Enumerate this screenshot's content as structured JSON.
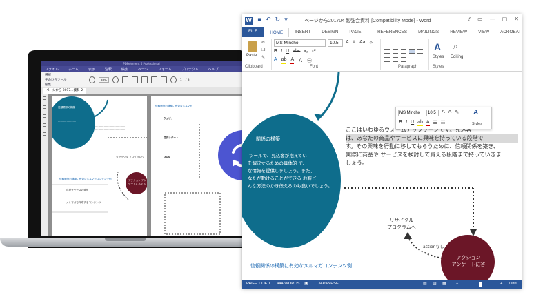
{
  "pdf": {
    "title": "PDFelement 6 Professional",
    "menu": [
      "ファイル",
      "ホーム",
      "表示",
      "注釈",
      "編集",
      "ページ",
      "フォーム",
      "プロテクト",
      "ヘルプ"
    ],
    "tools": [
      "選択",
      "手のひらツール",
      "編集"
    ],
    "zoom": "70%",
    "page_current": "1",
    "page_total": "/ 3",
    "tab": "ページから 2017...資料-2",
    "page1_heading": "信頼関係の構築",
    "page1_subheading": "信頼関係の構築に有効なメルマガコンテンツ例",
    "page1_item1": "自社サクセスの発信",
    "page1_item2": "メルマガで作成するコンテンツ",
    "page1_recycle": "リサイクル プログラムへ",
    "page1_action": "アクション アンケートに答える",
    "page2_heading": "信頼関係の構築に有効なメルマガ",
    "page2_webinar": "ウェビナー",
    "page2_report": "提供レポート",
    "page2_qa": "Q&A"
  },
  "word": {
    "doc_title": "ページから201704  勉強会資料 [Compatibility Mode] - Word",
    "tabs": [
      "FILE",
      "HOME",
      "INSERT",
      "DESIGN",
      "PAGE LAYOUT",
      "REFERENCES",
      "MAILINGS",
      "REVIEW",
      "VIEW",
      "ACROBAT"
    ],
    "ribbon": {
      "paste": "Paste",
      "font_name": "MS Mincho",
      "font_size": "10.5",
      "styles": "Styles",
      "editing": "Editing",
      "group_clipboard": "Clipboard",
      "group_font": "Font",
      "group_paragraph": "Paragraph",
      "group_styles": "Styles"
    },
    "mini_toolbar": {
      "font_name": "MS Mincho",
      "font_size": "10.5",
      "styles": "Styles"
    },
    "doc": {
      "ellipse_heading": "関係の構築",
      "ellipse_lines": [
        "ツールで、見込客が抱えてい",
        "を解決するための具体的 で、",
        "な情報を提供しましょう。また、",
        "なたが動けることができる お客ど",
        "んな方法のかき伝えるのも良いでしょう。"
      ],
      "main_lines": [
        "ここはいわゆるウォームアップゾーンです。見込客",
        "は、あなたの商品やサービスに興味を持っている段階で",
        "す。その興味を行動に移してもらうために、信頼関係を築き、",
        "実際に商品や サービスを検討して貰える段階まで持っていきま",
        "しょう。"
      ],
      "recycle": [
        "リサイクル",
        "プログラムへ"
      ],
      "action_nashi": "actionなし",
      "action": [
        "アクション",
        "アンケートに答"
      ],
      "bottom_link": "信頼関係の構築に有効なメルマガコンテンツ例"
    },
    "status": {
      "page": "PAGE 1 OF 1",
      "words": "444 WORDS",
      "language": "JAPANESE",
      "zoom": "100%"
    }
  },
  "colors": {
    "word_blue": "#2b579a",
    "teal": "#0e6d8c",
    "maroon": "#6b1627",
    "sync_blue": "#4c55d1",
    "pdf_purple": "#3d3f86"
  }
}
